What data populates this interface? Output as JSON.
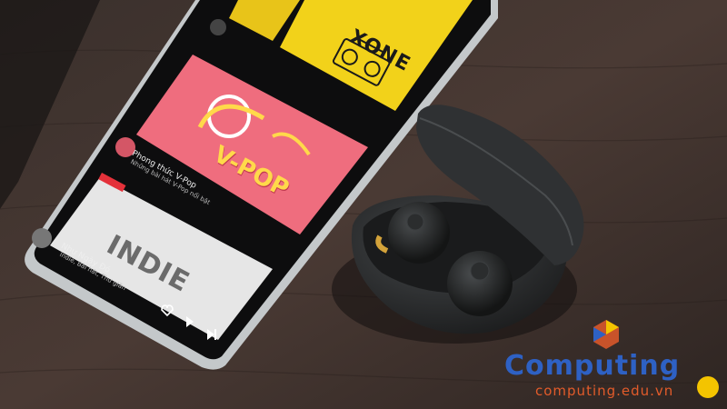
{
  "phone": {
    "banners": {
      "top": "XONE",
      "middle": "V-POP",
      "bottom": "INDIE"
    },
    "playlists": [
      {
        "title": "Phong thức V-Pop",
        "subtitle": "Những bài hát V-Pop nổi bật"
      },
      {
        "title": "Như Ngày Đó",
        "subtitle": "Indie, Bài hát, Thư giãn"
      }
    ],
    "colors": {
      "top_banner": "#f2d21a",
      "middle_banner": "#ef6d7e",
      "bottom_banner": "#eaeaea",
      "phone_body": "#bfc3c6"
    }
  },
  "earbuds_case": {
    "color": "#2b2d2e"
  },
  "watermark": {
    "brand": "Computing",
    "url": "computing.edu.vn",
    "colors": {
      "brand": "#2e61c4",
      "url": "#e25b2a"
    }
  }
}
